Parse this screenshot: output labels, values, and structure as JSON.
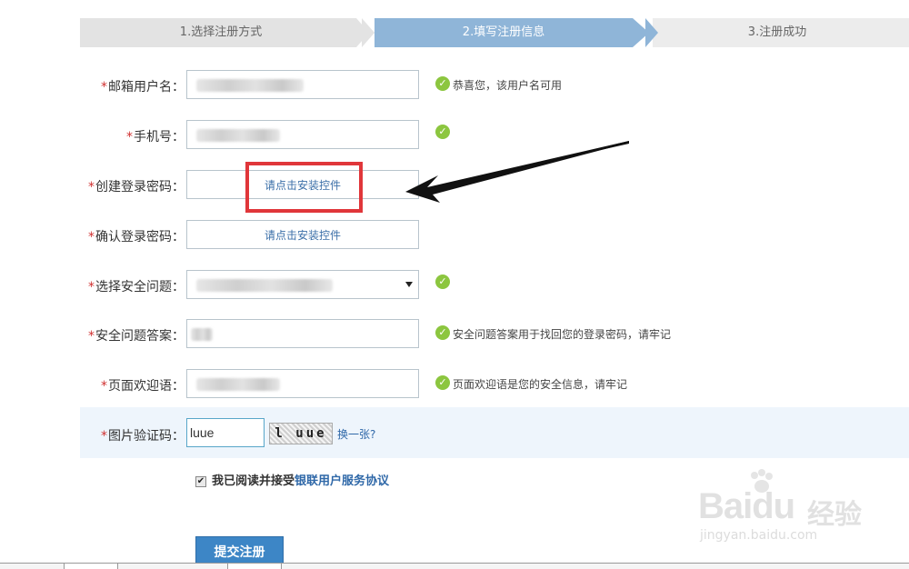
{
  "steps": [
    {
      "label": "1.选择注册方式"
    },
    {
      "label": "2.填写注册信息"
    },
    {
      "label": "3.注册成功"
    }
  ],
  "form": {
    "username": {
      "label": "邮箱用户名：",
      "required": "*",
      "hint": "恭喜您，该用户名可用"
    },
    "phone": {
      "label": "手机号：",
      "required": "*"
    },
    "password": {
      "label": "创建登录密码：",
      "required": "*",
      "control_text": "请点击安装控件"
    },
    "confirm_password": {
      "label": "确认登录密码：",
      "required": "*",
      "control_text": "请点击安装控件"
    },
    "security_question": {
      "label": "选择安全问题：",
      "required": "*"
    },
    "security_answer": {
      "label": "安全问题答案：",
      "required": "*",
      "hint": "安全问题答案用于找回您的登录密码，请牢记"
    },
    "welcome": {
      "label": "页面欢迎语：",
      "required": "*",
      "hint": "页面欢迎语是您的安全信息，请牢记"
    },
    "captcha": {
      "label": "图片验证码：",
      "required": "*",
      "value": "luue",
      "image_text": "l uue",
      "refresh_link": "换一张?"
    }
  },
  "agreement": {
    "checked": "✔",
    "prefix": "我已阅读并接受",
    "link": "银联用户服务协议"
  },
  "submit_label": "提交注册",
  "watermark": {
    "logo": "Baidu",
    "cn": "经验",
    "url": "jingyan.baidu.com"
  },
  "colors": {
    "step_active": "#8fb5d8",
    "step_inactive": "#e3e3e3",
    "required": "#d03030",
    "ok_icon": "#8cc63f",
    "link": "#2f68a8",
    "submit": "#3d86c6",
    "annotation_red": "#e0363a",
    "captcha_band": "#eef5fc"
  },
  "icons": {
    "ok": "check-circle-icon",
    "select_caret": "caret-down-icon",
    "arrow": "annotation-arrow-icon"
  }
}
